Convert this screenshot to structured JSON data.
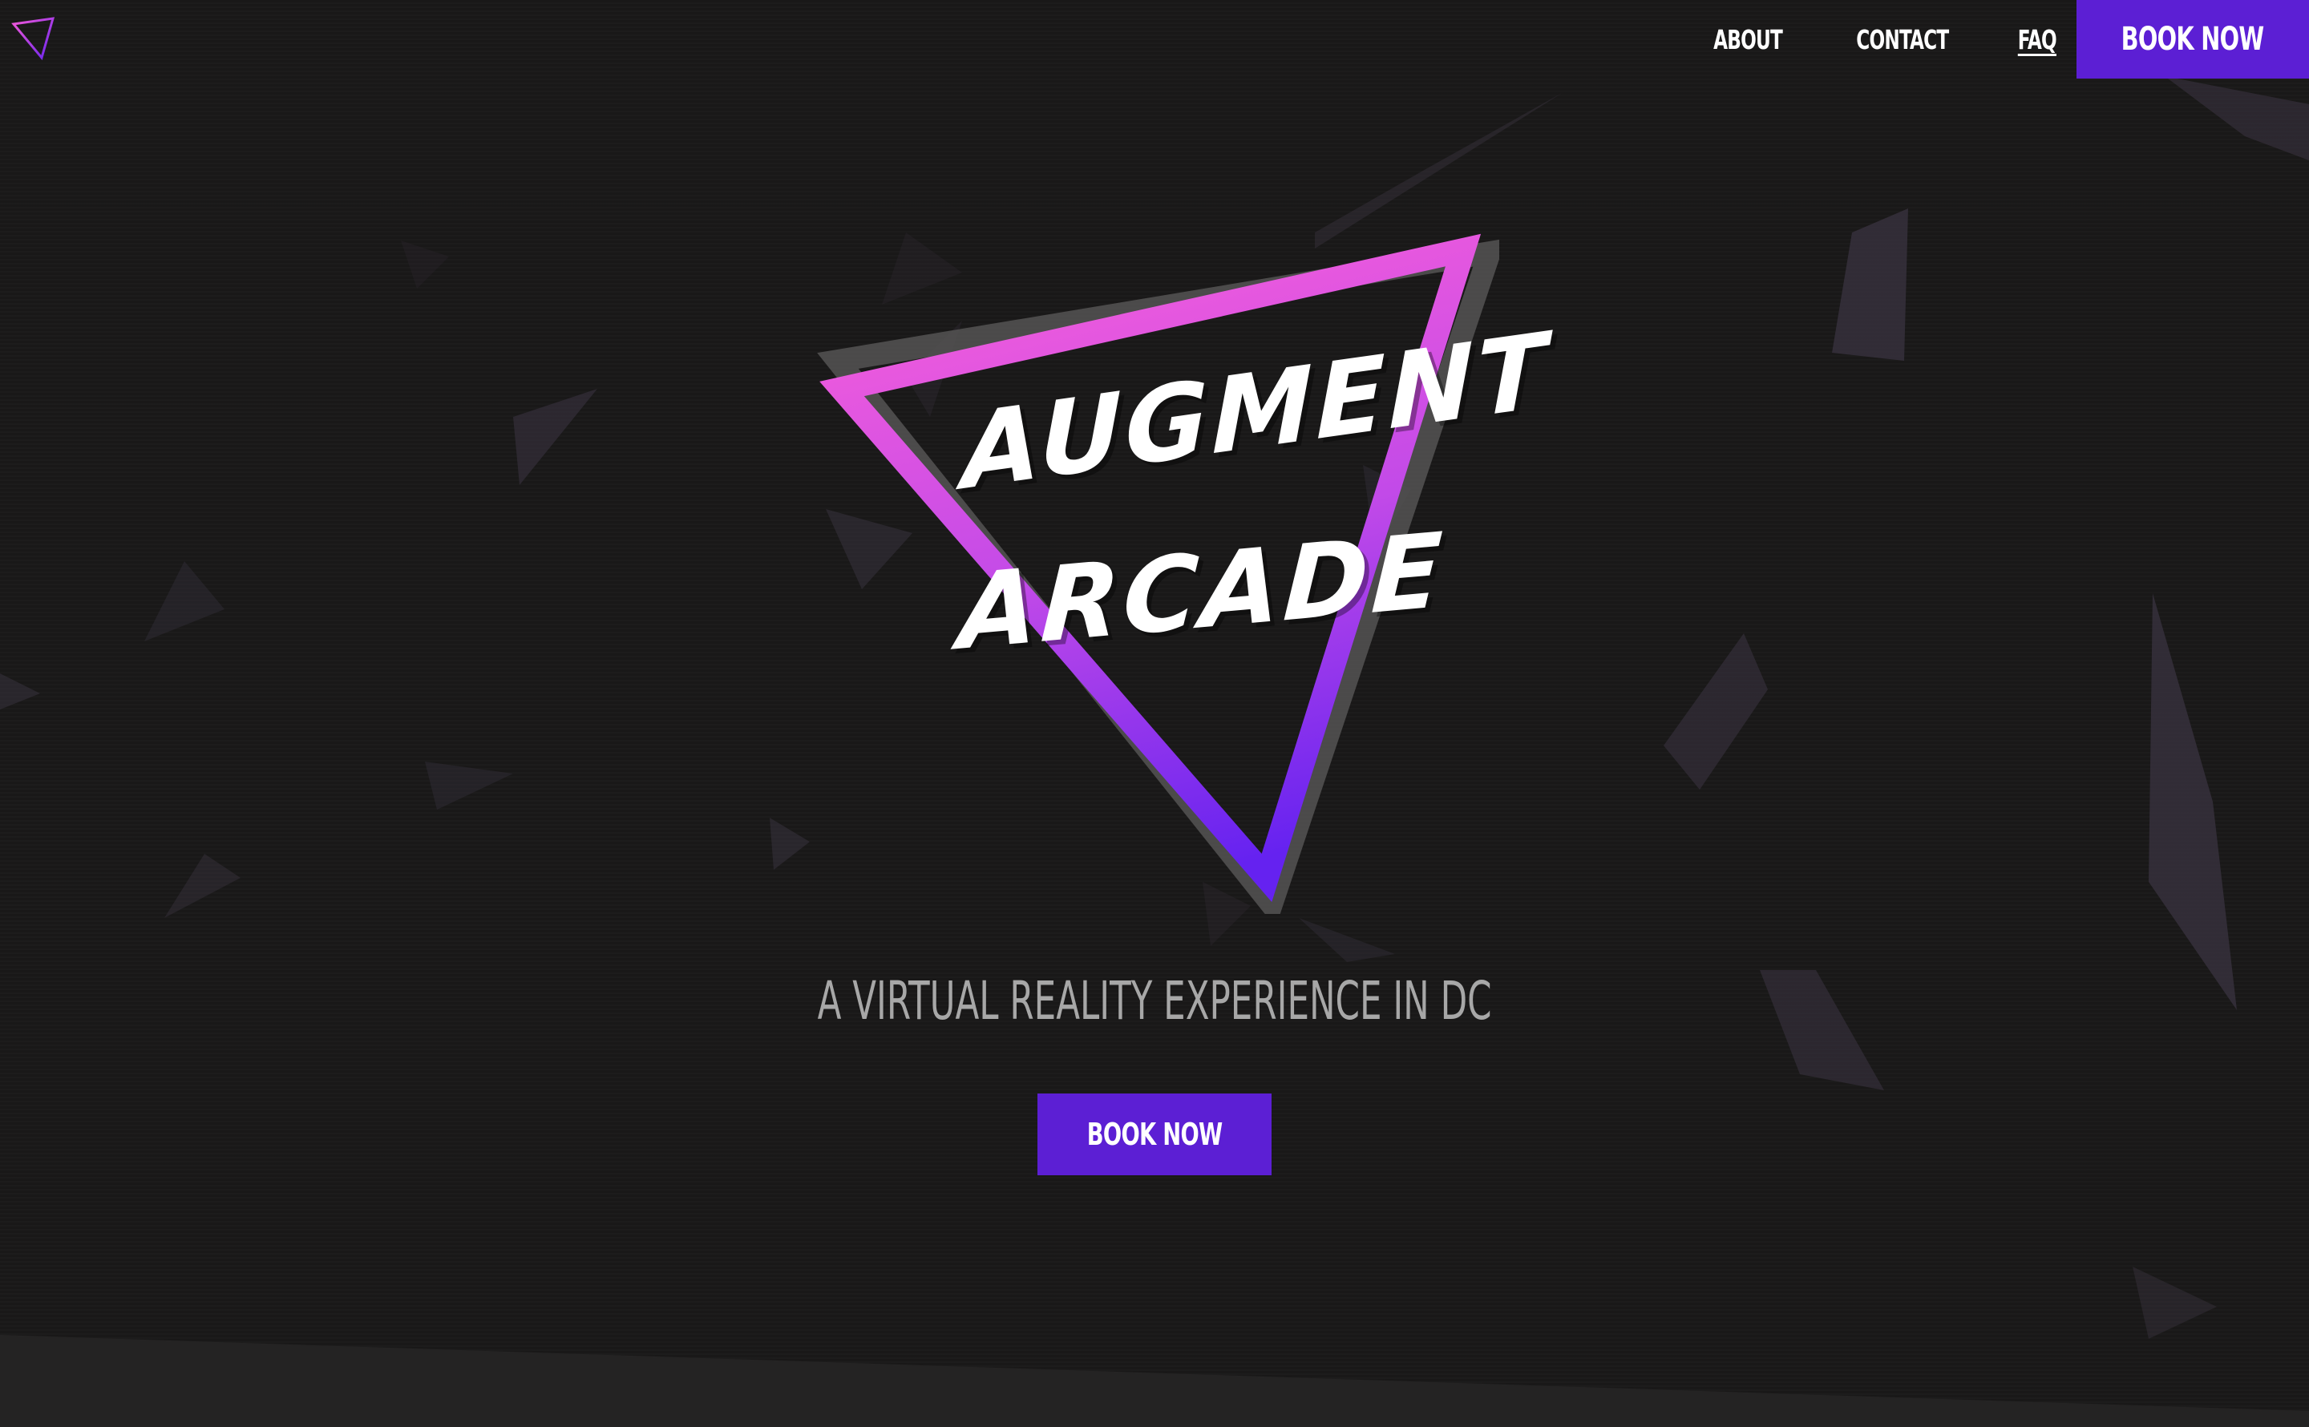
{
  "nav": {
    "logo_icon": "triangle-logo-icon",
    "links": [
      "ABOUT",
      "CONTACT",
      "FAQ"
    ],
    "book_label": "BOOK NOW"
  },
  "hero": {
    "logo_line1": "AUGMENT",
    "logo_line2": "ARCADE",
    "tagline": "A VIRTUAL REALITY EXPERIENCE IN DC",
    "book_label": "BOOK NOW"
  },
  "colors": {
    "background": "#1a1919",
    "accent_purple": "#5c1fd4",
    "gradient_pink": "#f25ad9",
    "gradient_violet": "#6a24ee",
    "shard": "#3d3442"
  }
}
